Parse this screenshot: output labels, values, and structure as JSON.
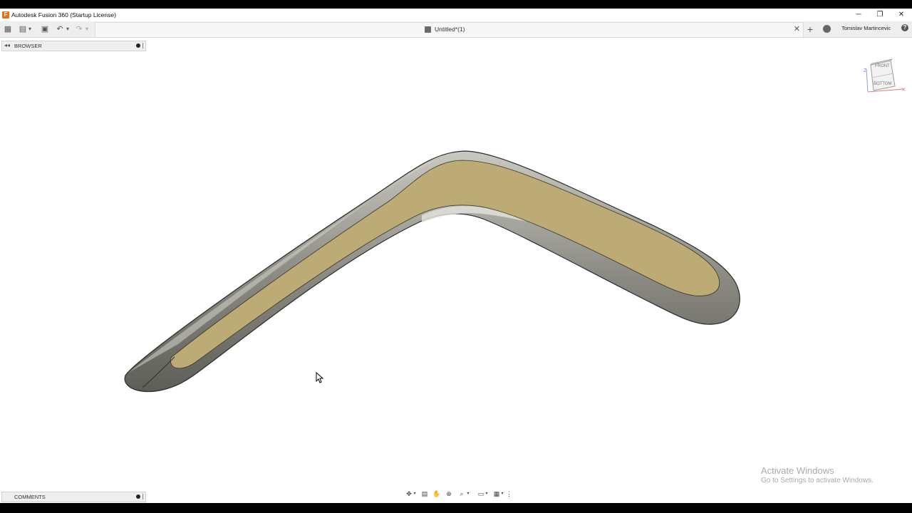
{
  "window": {
    "title": "Autodesk Fusion 360 (Startup License)",
    "app_icon": "F",
    "minimize_glyph": "─",
    "restore_glyph": "❐",
    "close_glyph": "✕"
  },
  "toolbar": {
    "apps_glyph": "▦",
    "file_glyph": "▤",
    "save_glyph": "▣",
    "undo_glyph": "↶",
    "redo_glyph": "↷",
    "dropdown_glyph": "▾",
    "document_title": "Untitled*(1)",
    "tab_close_glyph": "✕",
    "new_tab_glyph": "+",
    "user_name": "Tomislav Martincevic",
    "help_glyph": "?"
  },
  "browser": {
    "label": "BROWSER",
    "collapse_glyph": "◂◂"
  },
  "comments": {
    "label": "COMMENTS"
  },
  "viewcube": {
    "front_label": "FRONT",
    "bottom_label": "BOTTOM",
    "axis_z": "Z",
    "axis_x": "X"
  },
  "watermark": {
    "line1": "Activate Windows",
    "line2": "Go to Settings to activate Windows."
  },
  "colors": {
    "top_face": "#bcab74",
    "side_face": "#8a8a80",
    "toolbar_bg": "#eeeeee"
  },
  "icons": [
    "apps-grid-icon",
    "file-icon",
    "save-icon",
    "undo-icon",
    "redo-icon",
    "orbit-icon",
    "look-at-icon",
    "pan-icon",
    "zoom-icon",
    "fit-icon",
    "display-settings-icon",
    "grid-icon",
    "viewports-icon"
  ]
}
